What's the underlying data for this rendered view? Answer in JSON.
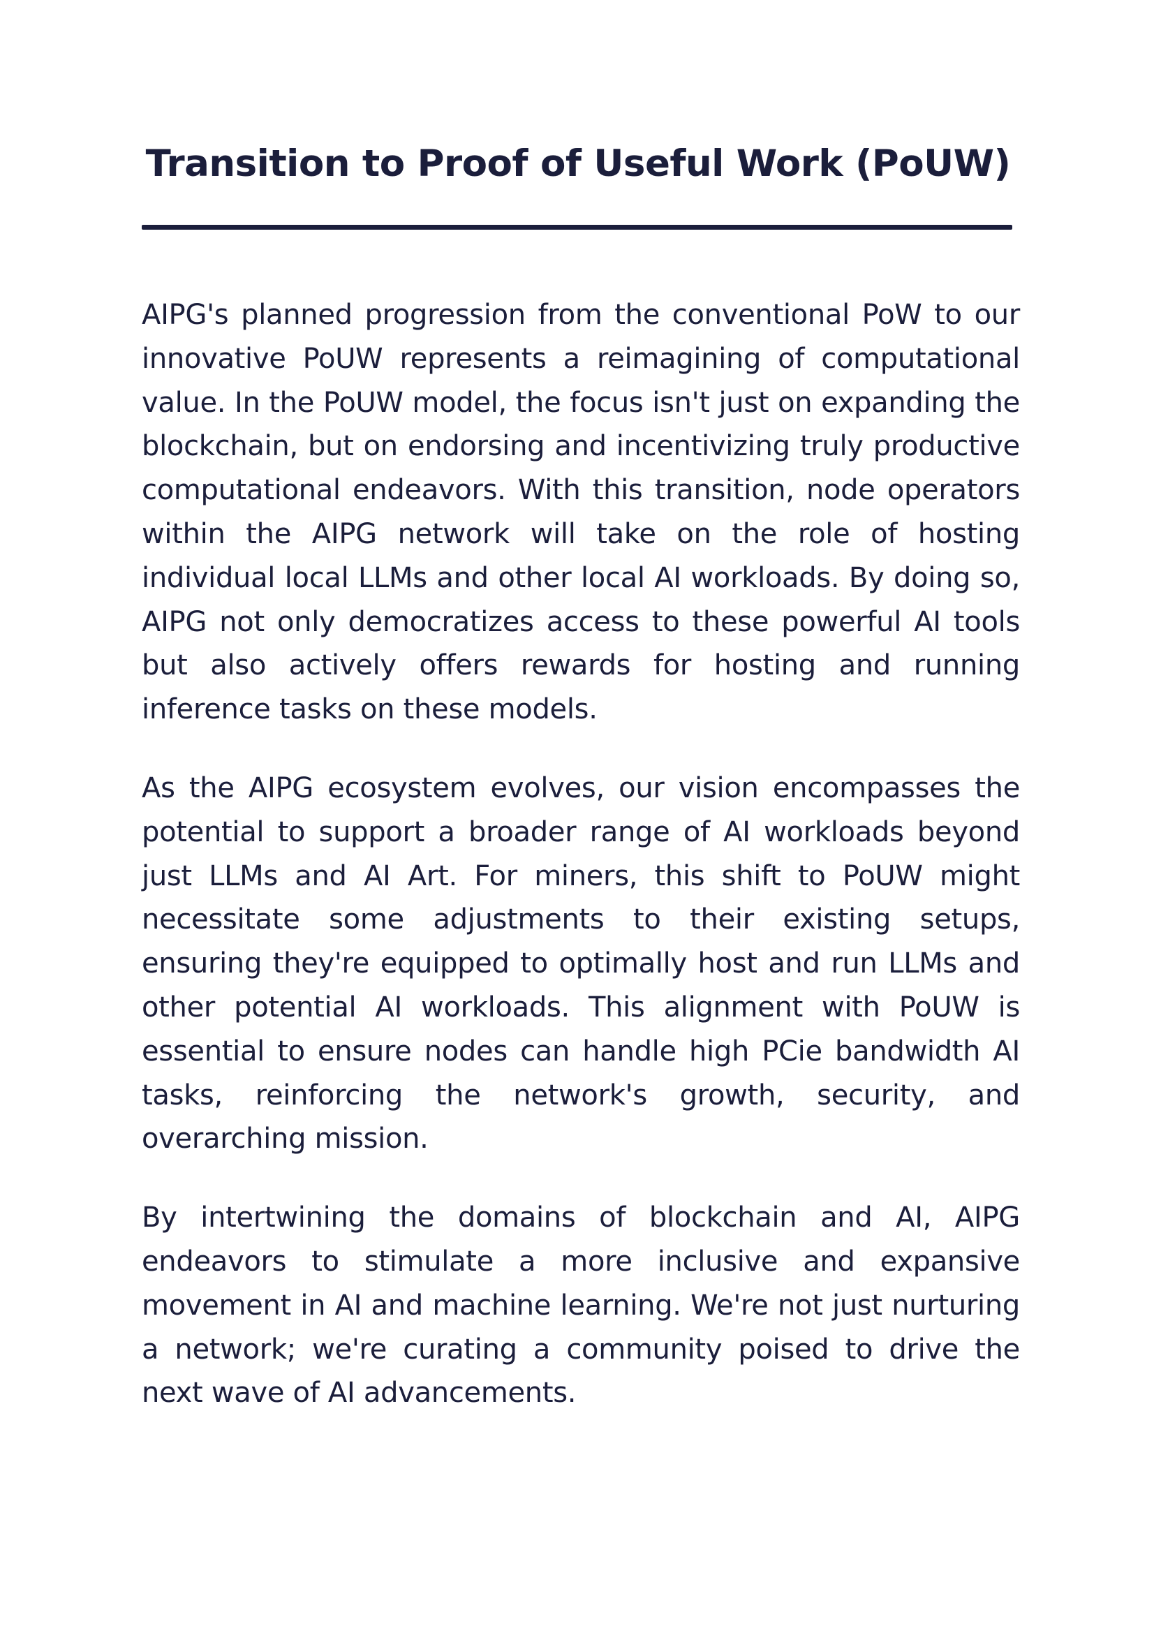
{
  "document": {
    "title": "Transition to Proof of Useful Work (PoUW)",
    "paragraphs": [
      "AIPG's planned progression from the conventional PoW to our innovative PoUW represents a reimagining of computational value. In the PoUW model, the focus isn't just on expanding the blockchain, but on endorsing and incentivizing truly productive computational endeavors. With this transition, node operators within the AIPG network will take on the role of hosting individual local LLMs and other local AI workloads. By doing so, AIPG not only democratizes access to these powerful AI tools but also actively offers rewards for hosting and running inference tasks on these models.",
      "As the AIPG ecosystem evolves, our vision encompasses the potential to support a broader range of AI workloads beyond just LLMs and AI Art. For miners, this shift to PoUW might necessitate some adjustments to their existing setups, ensuring they're equipped to optimally host and run LLMs and other potential AI workloads. This alignment with PoUW is essential to ensure nodes can handle high PCie bandwidth AI tasks, reinforcing the network's growth, security, and overarching mission.",
      "By intertwining the domains of blockchain and AI, AIPG endeavors to stimulate a more inclusive and expansive movement in AI and machine learning. We're not just nurturing a network; we're curating a community poised to drive the next wave of AI advancements."
    ]
  },
  "colors": {
    "text": "#1b1e3b",
    "background": "#ffffff"
  }
}
